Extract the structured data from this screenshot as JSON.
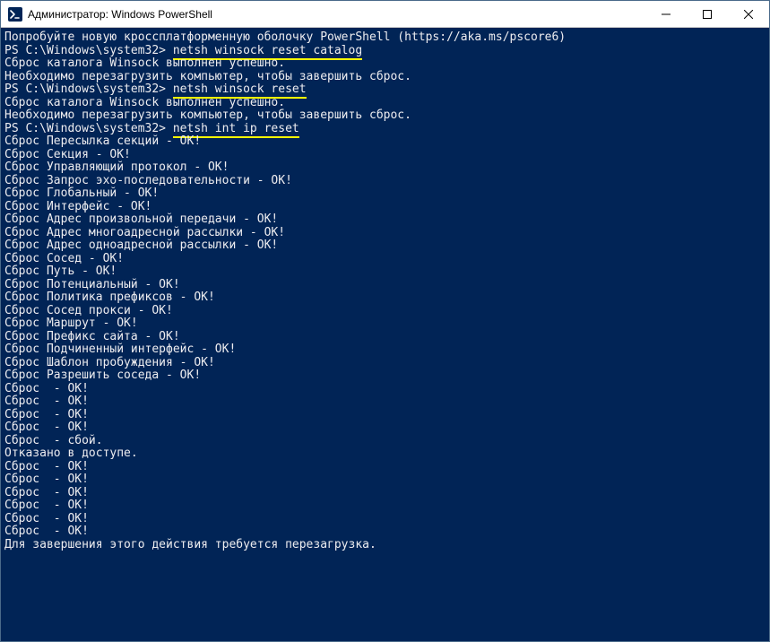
{
  "window": {
    "title": "Администратор: Windows PowerShell"
  },
  "terminal": {
    "banner": "Попробуйте новую кроссплатформенную оболочку PowerShell (https://aka.ms/pscore6)",
    "prompt_prefix": "PS C:\\Windows\\system32> ",
    "cmd1": "netsh winsock reset catalog",
    "out1a": "Сброс каталога Winsock выполнен успешно.",
    "out1b": "Необходимо перезагрузить компьютер, чтобы завершить сброс.",
    "cmd2": "netsh winsock reset",
    "out2a": "Сброс каталога Winsock выполнен успешно.",
    "out2b": "Необходимо перезагрузить компьютер, чтобы завершить сброс.",
    "cmd3": "netsh int ip reset",
    "ip_lines": [
      "Сброс Пересылка секций - OK!",
      "Сброс Секция - OK!",
      "Сброс Управляющий протокол - OK!",
      "Сброс Запрос эхо-последовательности - OK!",
      "Сброс Глобальный - OK!",
      "Сброс Интерфейс - OK!",
      "Сброс Адрес произвольной передачи - OK!",
      "Сброс Адрес многоадресной рассылки - OK!",
      "Сброс Адрес одноадресной рассылки - OK!",
      "Сброс Сосед - OK!",
      "Сброс Путь - OK!",
      "Сброс Потенциальный - OK!",
      "Сброс Политика префиксов - OK!",
      "Сброс Сосед прокси - OK!",
      "Сброс Маршрут - OK!",
      "Сброс Префикс сайта - OK!",
      "Сброс Подчиненный интерфейс - OK!",
      "Сброс Шаблон пробуждения - OK!",
      "Сброс Разрешить соседа - OK!",
      "Сброс  - OK!",
      "Сброс  - OK!",
      "Сброс  - OK!",
      "Сброс  - OK!",
      "Сброс  - сбой.",
      "Отказано в доступе.",
      "",
      "Сброс  - OK!",
      "Сброс  - OK!",
      "Сброс  - OK!",
      "Сброс  - OK!",
      "Сброс  - OK!",
      "Сброс  - OK!",
      "Для завершения этого действия требуется перезагрузка."
    ]
  },
  "colors": {
    "terminal_bg": "#012456",
    "terminal_fg": "#eeedf0",
    "highlight": "#ffff00"
  }
}
